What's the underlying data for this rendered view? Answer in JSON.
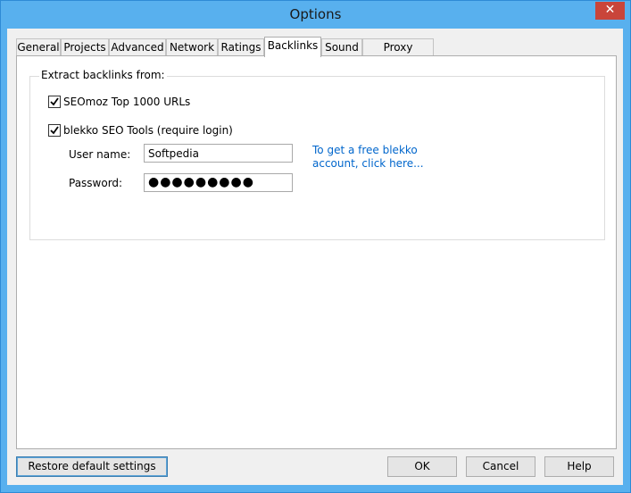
{
  "window": {
    "title": "Options",
    "close_glyph": "✕"
  },
  "tabs": [
    {
      "label": "General"
    },
    {
      "label": "Projects"
    },
    {
      "label": "Advanced"
    },
    {
      "label": "Network"
    },
    {
      "label": "Ratings"
    },
    {
      "label": "Backlinks"
    },
    {
      "label": "Sound"
    },
    {
      "label": "Proxy Servers"
    }
  ],
  "active_tab": "Backlinks",
  "backlinks": {
    "group_label": "Extract backlinks from:",
    "seomoz": {
      "label": "SEOmoz Top 1000 URLs",
      "checked": true
    },
    "blekko": {
      "label": "blekko SEO Tools (require login)",
      "checked": true
    },
    "username_label": "User name:",
    "username_value": "Softpedia",
    "password_label": "Password:",
    "password_value": "●●●●●●●●●",
    "signup_link": "To get a free blekko account, click here..."
  },
  "buttons": {
    "restore": "Restore default settings",
    "ok": "OK",
    "cancel": "Cancel",
    "help": "Help"
  },
  "colors": {
    "titlebar": "#58b0ee",
    "close": "#c9453a",
    "link": "#0066cc"
  }
}
